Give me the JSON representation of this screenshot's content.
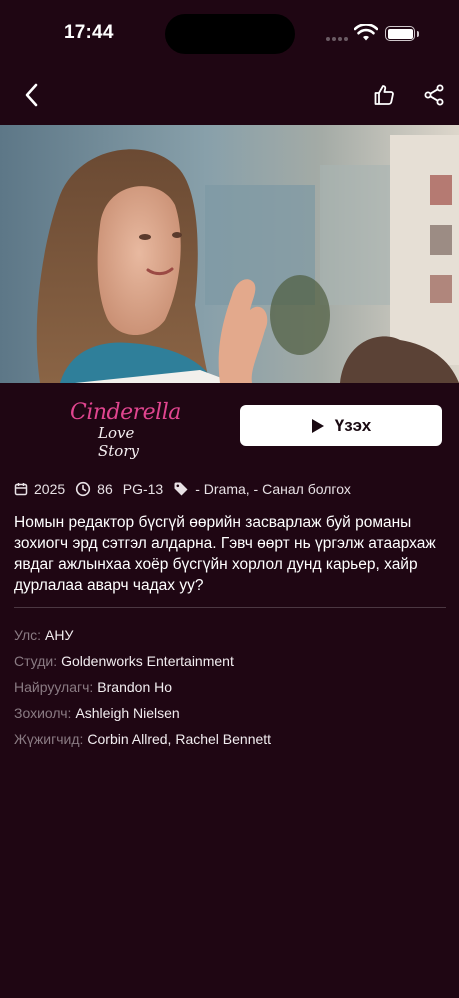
{
  "status_bar": {
    "time": "17:44"
  },
  "movie": {
    "logo_line1": "Cinderella",
    "logo_line2": "Love Story",
    "watch_label": "Үзэх",
    "year": "2025",
    "duration": "86",
    "rating": "PG-13",
    "genres": "- Drama, - Санал болгох",
    "description": "Номын редактор бүсгүй өөрийн засварлаж буй романы зохиогч эрд сэтгэл алдарна. Гэвч өөрт нь үргэлж атаархаж явдаг ажлынхаа хоёр бүсгүйн хорлол дунд карьер, хайр дурлалаа аварч чадах уу?"
  },
  "credits": [
    {
      "label": "Улс:",
      "value": "АНУ"
    },
    {
      "label": "Студи:",
      "value": "Goldenworks Entertainment"
    },
    {
      "label": "Найруулагч:",
      "value": "Brandon Ho"
    },
    {
      "label": "Зохиолч:",
      "value": "Ashleigh Nielsen"
    },
    {
      "label": "Жүжигчид:",
      "value": "Corbin Allred, Rachel Bennett"
    }
  ],
  "colors": {
    "background": "#1f0613",
    "logo_pink": "#e0458f",
    "button_bg": "#ffffff"
  },
  "icons": {
    "back": "chevron-left-icon",
    "like": "thumbs-up-icon",
    "share": "share-icon",
    "play": "play-icon",
    "calendar": "calendar-icon",
    "clock": "clock-icon",
    "tag": "tag-icon"
  }
}
